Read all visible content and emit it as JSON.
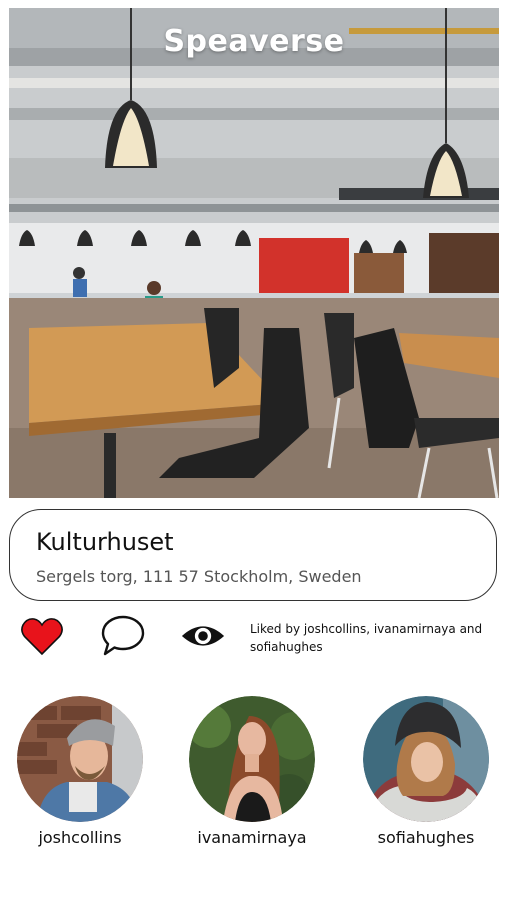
{
  "app": {
    "title": "Speaverse"
  },
  "place": {
    "name": "Kulturhuset",
    "address": "Sergels torg, 111 57 Stockholm, Sweden"
  },
  "actions": {
    "like_icon": "heart-icon",
    "comment_icon": "comment-icon",
    "view_icon": "eye-icon",
    "liked_text": "Liked by joshcollins, ivanamirnaya and sofiahughes",
    "like_color": "#e8131b"
  },
  "users": [
    {
      "username": "joshcollins"
    },
    {
      "username": "ivanamirnaya"
    },
    {
      "username": "sofiahughes"
    }
  ]
}
